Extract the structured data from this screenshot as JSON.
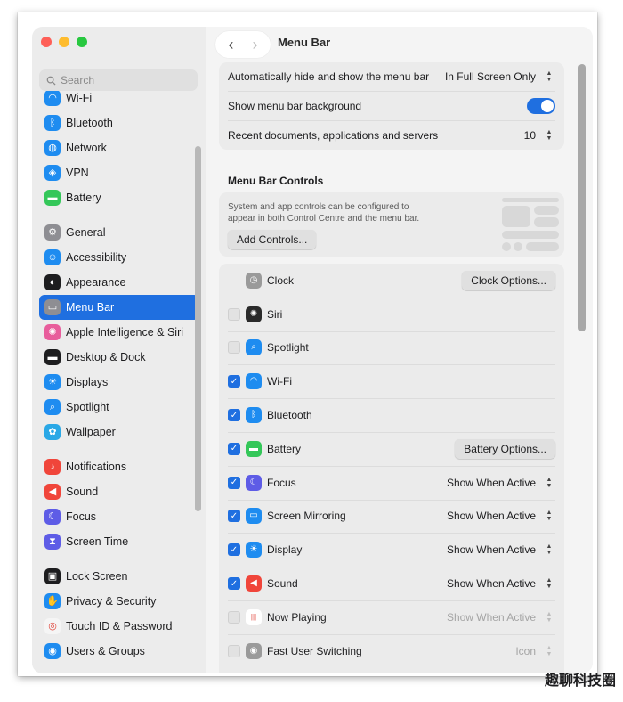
{
  "window": {
    "title": "Menu Bar"
  },
  "sidebar": {
    "search_placeholder": "Search",
    "items": [
      {
        "label": "Wi-Fi",
        "icon": "wifi-icon",
        "color": "#1e8cf0"
      },
      {
        "label": "Bluetooth",
        "icon": "bluetooth-icon",
        "color": "#1e8cf0"
      },
      {
        "label": "Network",
        "icon": "globe-icon",
        "color": "#1e8cf0"
      },
      {
        "label": "VPN",
        "icon": "vpn-icon",
        "color": "#1e8cf0"
      },
      {
        "label": "Battery",
        "icon": "battery-icon",
        "color": "#34c759"
      },
      {
        "label": "General",
        "icon": "gear-icon",
        "color": "#8e8e93"
      },
      {
        "label": "Accessibility",
        "icon": "accessibility-icon",
        "color": "#1e8cf0"
      },
      {
        "label": "Appearance",
        "icon": "appearance-icon",
        "color": "#1d1d1f"
      },
      {
        "label": "Menu Bar",
        "icon": "menu-bar-icon",
        "color": "#8e8e93"
      },
      {
        "label": "Apple Intelligence & Siri",
        "icon": "siri-icon",
        "color": "#e85d9c"
      },
      {
        "label": "Desktop & Dock",
        "icon": "dock-icon",
        "color": "#1d1d1f"
      },
      {
        "label": "Displays",
        "icon": "sun-icon",
        "color": "#1e8cf0"
      },
      {
        "label": "Spotlight",
        "icon": "magnifier-icon",
        "color": "#1e8cf0"
      },
      {
        "label": "Wallpaper",
        "icon": "flower-icon",
        "color": "#2aa8e6"
      },
      {
        "label": "Notifications",
        "icon": "bell-icon",
        "color": "#f0453a"
      },
      {
        "label": "Sound",
        "icon": "speaker-icon",
        "color": "#f0453a"
      },
      {
        "label": "Focus",
        "icon": "moon-icon",
        "color": "#5e5ce6"
      },
      {
        "label": "Screen Time",
        "icon": "hourglass-icon",
        "color": "#5e5ce6"
      },
      {
        "label": "Lock Screen",
        "icon": "lock-icon",
        "color": "#1d1d1f"
      },
      {
        "label": "Privacy & Security",
        "icon": "hand-icon",
        "color": "#1e8cf0"
      },
      {
        "label": "Touch ID & Password",
        "icon": "fingerprint-icon",
        "color": "#f5f5f5"
      },
      {
        "label": "Users & Groups",
        "icon": "users-icon",
        "color": "#1e8cf0"
      }
    ]
  },
  "settings": {
    "auto_hide_label": "Automatically hide and show the menu bar",
    "auto_hide_value": "In Full Screen Only",
    "show_bg_label": "Show menu bar background",
    "recent_label": "Recent documents, applications and servers",
    "recent_value": "10"
  },
  "controls": {
    "section_title": "Menu Bar Controls",
    "description": "System and app controls can be configured to appear in both Control Centre and the menu bar.",
    "add_button": "Add Controls..."
  },
  "items": [
    {
      "label": "Clock",
      "checkbox": "none",
      "icon": "clock-icon",
      "color": "#9a9a9a",
      "action": "button",
      "action_label": "Clock Options..."
    },
    {
      "label": "Siri",
      "checkbox": "off",
      "icon": "siri-icon",
      "color": "#2a2a2a",
      "action": "none",
      "action_label": ""
    },
    {
      "label": "Spotlight",
      "checkbox": "off",
      "icon": "magnifier-icon",
      "color": "#1e8cf0",
      "action": "none",
      "action_label": ""
    },
    {
      "label": "Wi-Fi",
      "checkbox": "on",
      "icon": "wifi-icon",
      "color": "#1e8cf0",
      "action": "none",
      "action_label": ""
    },
    {
      "label": "Bluetooth",
      "checkbox": "on",
      "icon": "bluetooth-icon",
      "color": "#1e8cf0",
      "action": "none",
      "action_label": ""
    },
    {
      "label": "Battery",
      "checkbox": "on",
      "icon": "battery-icon",
      "color": "#34c759",
      "action": "button",
      "action_label": "Battery Options..."
    },
    {
      "label": "Focus",
      "checkbox": "on",
      "icon": "moon-icon",
      "color": "#5e5ce6",
      "action": "select",
      "action_label": "Show When Active"
    },
    {
      "label": "Screen Mirroring",
      "checkbox": "on",
      "icon": "mirroring-icon",
      "color": "#1e8cf0",
      "action": "select",
      "action_label": "Show When Active"
    },
    {
      "label": "Display",
      "checkbox": "on",
      "icon": "sun-icon",
      "color": "#1e8cf0",
      "action": "select",
      "action_label": "Show When Active"
    },
    {
      "label": "Sound",
      "checkbox": "on",
      "icon": "speaker-icon",
      "color": "#f0453a",
      "action": "select",
      "action_label": "Show When Active"
    },
    {
      "label": "Now Playing",
      "checkbox": "off",
      "icon": "waveform-icon",
      "color": "#ffffff",
      "action": "select-dim",
      "action_label": "Show When Active"
    },
    {
      "label": "Fast User Switching",
      "checkbox": "off",
      "icon": "user-icon",
      "color": "#9a9a9a",
      "action": "select-dim",
      "action_label": "Icon"
    }
  ],
  "watermark": "趣聊科技圈"
}
